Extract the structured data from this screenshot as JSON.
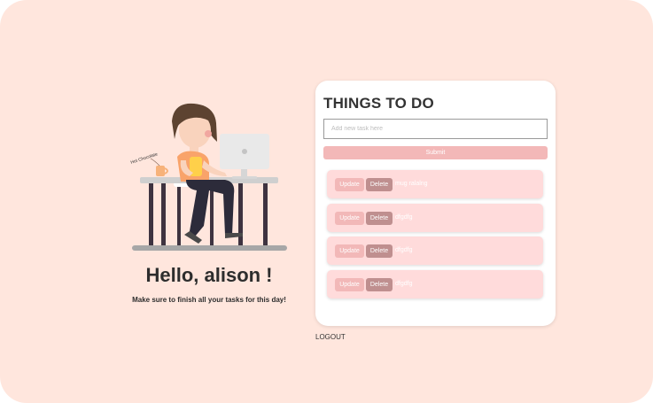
{
  "greeting": {
    "title": "Hello, alison !",
    "subtitle": "Make sure to finish all your tasks for this day!"
  },
  "illustration": {
    "mug_label": "Hot Chocolate"
  },
  "todo": {
    "title": "THINGS TO DO",
    "input_placeholder": "Add new task here",
    "submit_label": "Submit",
    "update_label": "Update",
    "delete_label": "Delete",
    "tasks": [
      {
        "text": "mug ralalng"
      },
      {
        "text": "dfgdfg"
      },
      {
        "text": "dfgdfg"
      },
      {
        "text": "dfgdfg"
      }
    ]
  },
  "logout_label": "LOGOUT",
  "colors": {
    "background": "#ffe6dd",
    "card": "#ffffff",
    "submit": "#f3b8b8",
    "task_bg": "#ffdbdb",
    "update_btn": "#f2b8b8",
    "delete_btn": "#bf8f8f"
  }
}
